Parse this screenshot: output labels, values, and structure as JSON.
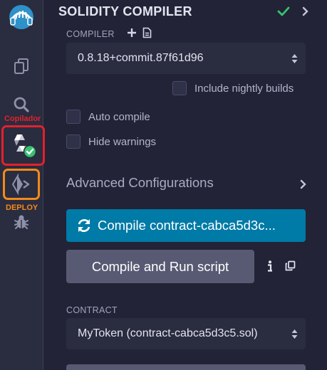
{
  "rail": {
    "compiler_caption": "Copilador",
    "deploy_caption": "DEPLOY",
    "colors": {
      "red_highlight": "#e5202c",
      "orange_highlight": "#f28a1a",
      "green_check": "#36c46f"
    }
  },
  "panel": {
    "title": "SOLIDITY COMPILER",
    "compiler_label": "COMPILER",
    "compiler_version": "0.8.18+commit.87f61d96",
    "include_nightly_label": "Include nightly builds",
    "auto_compile_label": "Auto compile",
    "hide_warnings_label": "Hide warnings",
    "advanced_label": "Advanced Configurations",
    "compile_button_label": "Compile contract-cabca5d3c...",
    "compile_run_label": "Compile and Run script",
    "contract_label": "CONTRACT",
    "contract_selected": "MyToken (contract-cabca5d3c5.sol)"
  },
  "colors": {
    "accent": "#007aa6",
    "success": "#36c46f",
    "panel_bg": "#222336",
    "rail_bg": "#2a2c3f"
  }
}
